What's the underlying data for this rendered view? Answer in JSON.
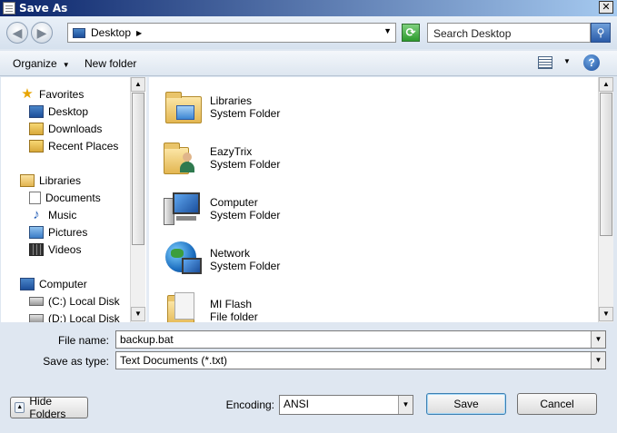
{
  "window": {
    "title": "Save As",
    "close_label": "✕"
  },
  "nav": {
    "back_glyph": "◀",
    "forward_glyph": "▶"
  },
  "address": {
    "crumb": "Desktop",
    "crumb_arrow": "▶",
    "dropdown_glyph": "▼",
    "refresh_glyph": "⟳"
  },
  "search": {
    "placeholder": "Search Desktop",
    "button_glyph": "⚲"
  },
  "toolbar": {
    "organize_label": "Organize",
    "organize_arrow": "▼",
    "new_folder_label": "New folder",
    "view_arrow": "▼",
    "help_label": "?"
  },
  "sidebar": {
    "items": [
      {
        "label": "Favorites",
        "icon": "star-icon"
      },
      {
        "label": "Desktop",
        "icon": "desktop-icon"
      },
      {
        "label": "Downloads",
        "icon": "downloads-icon"
      },
      {
        "label": "Recent Places",
        "icon": "recent-places-icon"
      },
      {
        "label": "Libraries",
        "icon": "libraries-icon"
      },
      {
        "label": "Documents",
        "icon": "documents-icon"
      },
      {
        "label": "Music",
        "icon": "music-icon"
      },
      {
        "label": "Pictures",
        "icon": "pictures-icon"
      },
      {
        "label": "Videos",
        "icon": "videos-icon"
      },
      {
        "label": "Computer",
        "icon": "computer-icon"
      },
      {
        "label": "(C:) Local Disk",
        "icon": "disk-icon"
      },
      {
        "label": "(D:) Local Disk",
        "icon": "disk-icon"
      }
    ],
    "star_glyph": "★",
    "music_glyph": "♪"
  },
  "files": [
    {
      "name": "Libraries",
      "type": "System Folder",
      "icon": "libraries-folder-icon"
    },
    {
      "name": "EazyTrix",
      "type": "System Folder",
      "icon": "user-folder-icon"
    },
    {
      "name": "Computer",
      "type": "System Folder",
      "icon": "computer-icon"
    },
    {
      "name": "Network",
      "type": "System Folder",
      "icon": "network-icon"
    },
    {
      "name": "MI Flash",
      "type": "File folder",
      "icon": "folder-icon"
    }
  ],
  "scroll": {
    "up": "▲",
    "down": "▼"
  },
  "form": {
    "file_name_label": "File name:",
    "file_name_value": "backup.bat",
    "save_as_type_label": "Save as type:",
    "save_as_type_value": "Text Documents (*.txt)",
    "encoding_label": "Encoding:",
    "encoding_value": "ANSI",
    "dd_glyph": "▼"
  },
  "buttons": {
    "hide_folders": "Hide Folders",
    "hide_chevron": "▲",
    "save": "Save",
    "cancel": "Cancel"
  }
}
